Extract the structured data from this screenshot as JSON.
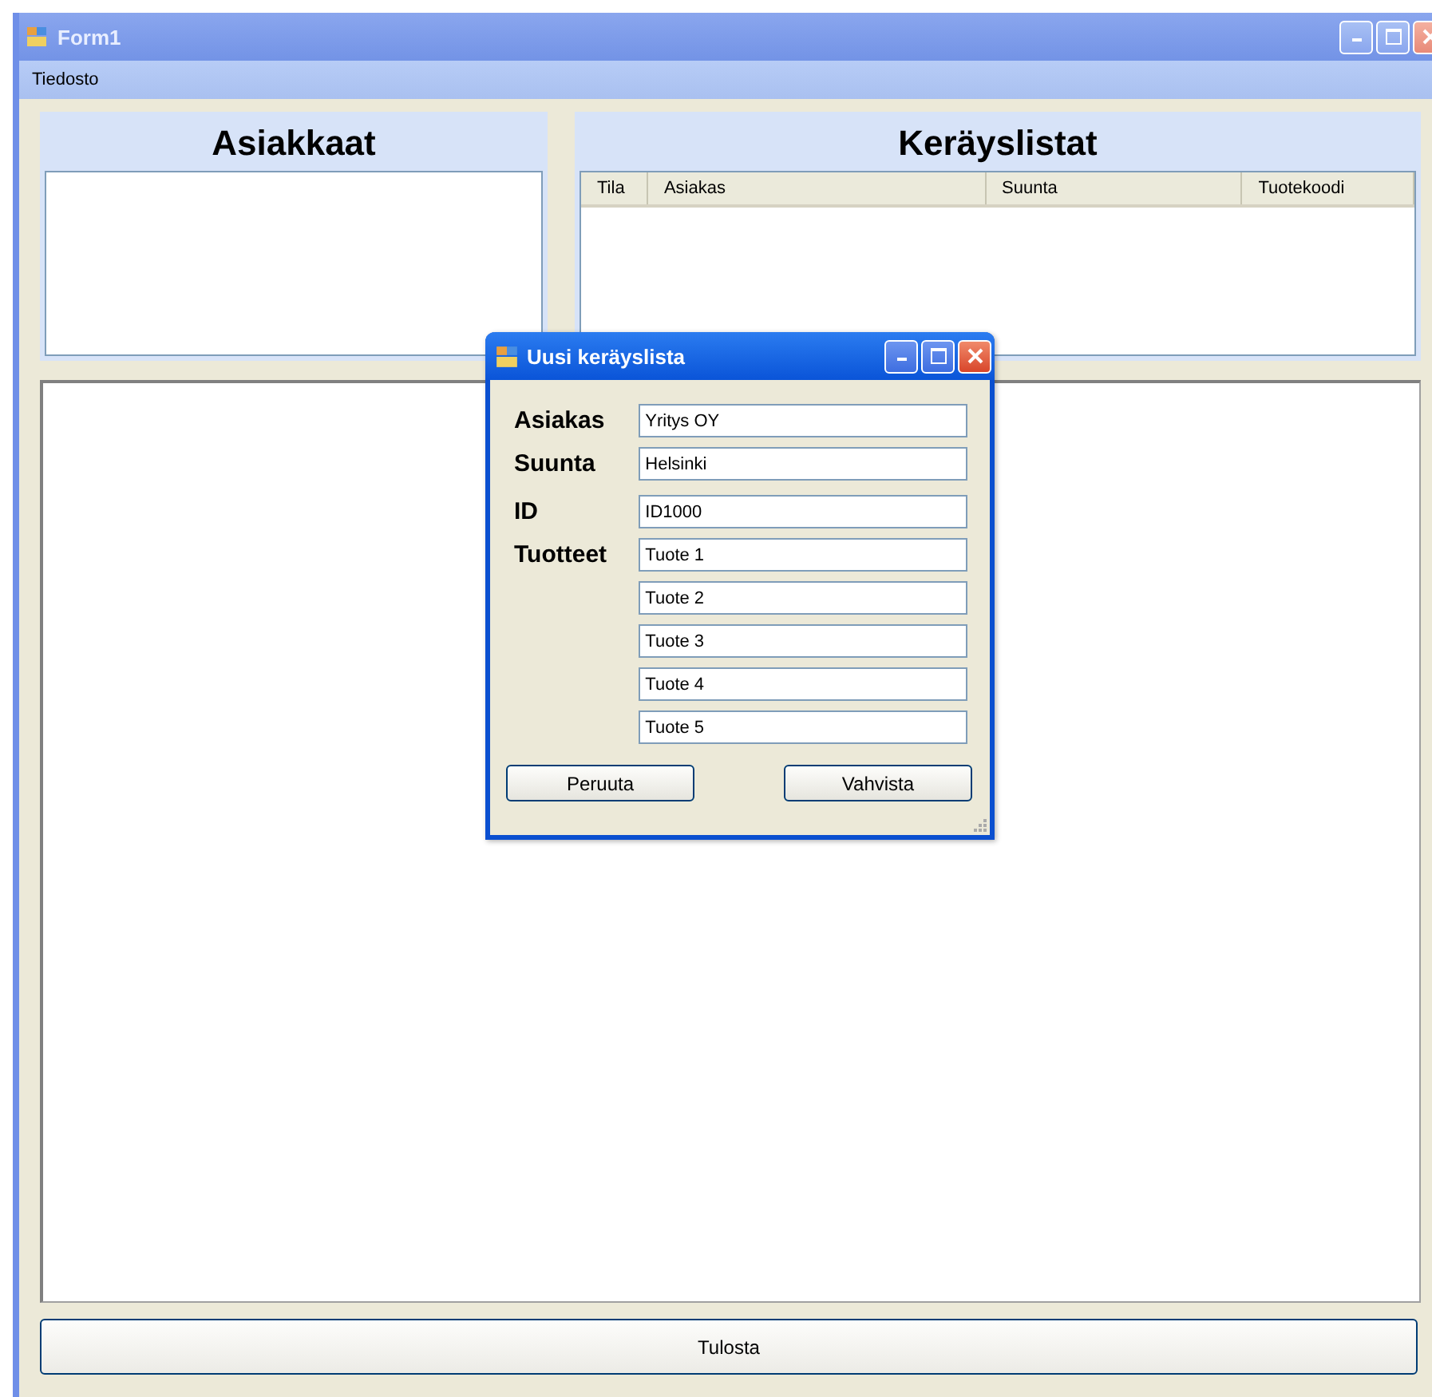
{
  "window": {
    "title": "Form1"
  },
  "menu": [
    "Tiedosto"
  ],
  "customers_panel": {
    "title": "Asiakkaat"
  },
  "lists_panel": {
    "title": "Keräyslistat",
    "columns": [
      "Tila",
      "Asiakas",
      "Suunta",
      "Tuotekoodi"
    ]
  },
  "print_button": "Tulosta",
  "dialog": {
    "title": "Uusi keräyslista",
    "fields": [
      {
        "label": "Asiakas",
        "value": "Yritys OY"
      },
      {
        "label": "Suunta",
        "value": "Helsinki"
      },
      {
        "label": "ID",
        "value": "ID1000"
      }
    ],
    "products": {
      "label": "Tuotteet",
      "values": [
        "Tuote 1",
        "Tuote 2",
        "Tuote 3",
        "Tuote 4",
        "Tuote 5"
      ]
    },
    "buttons": [
      "Peruuta",
      "Vahvista"
    ]
  }
}
